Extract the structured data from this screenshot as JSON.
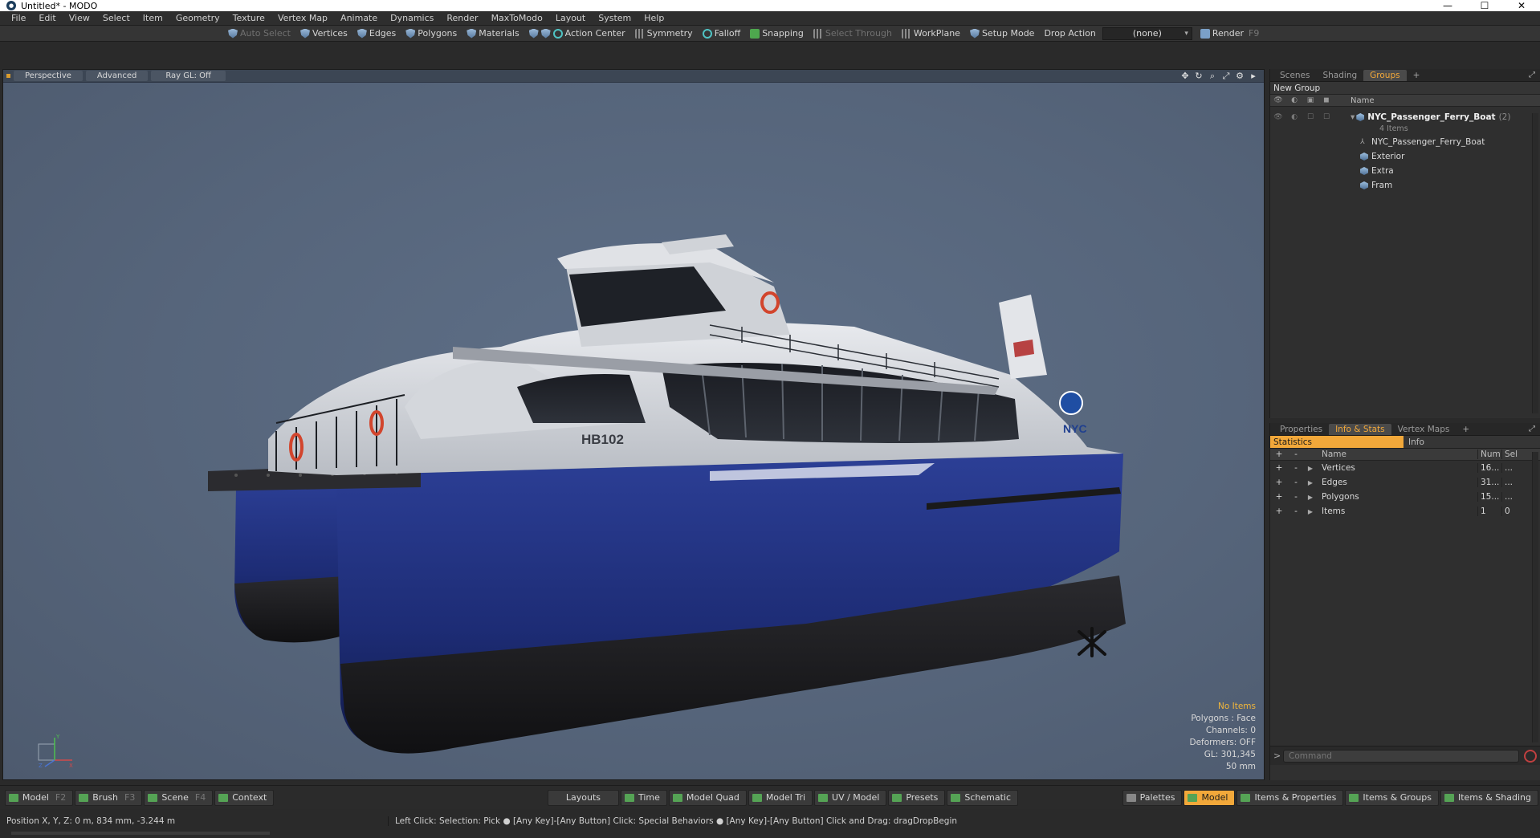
{
  "window": {
    "title": "Untitled* - MODO",
    "minimize": "—",
    "maximize": "☐",
    "close": "✕"
  },
  "menu": [
    "File",
    "Edit",
    "View",
    "Select",
    "Item",
    "Geometry",
    "Texture",
    "Vertex Map",
    "Animate",
    "Dynamics",
    "Render",
    "MaxToModo",
    "Layout",
    "System",
    "Help"
  ],
  "toolbar": {
    "auto_select": "Auto Select",
    "vertices": "Vertices",
    "edges": "Edges",
    "polygons": "Polygons",
    "materials": "Materials",
    "action_center": "Action Center",
    "symmetry": "Symmetry",
    "falloff": "Falloff",
    "snapping": "Snapping",
    "select_through": "Select Through",
    "workplane": "WorkPlane",
    "setup_mode": "Setup Mode",
    "drop_action": "Drop Action",
    "drop_value": "(none)",
    "render": "Render",
    "render_key": "F9"
  },
  "viewport": {
    "tabs": [
      "Perspective",
      "Advanced",
      "Ray GL: Off"
    ],
    "hull_label": "HB102",
    "logo_text": "NYC",
    "stats": {
      "no_items": "No Items",
      "polygons": "Polygons : Face",
      "channels": "Channels: 0",
      "deformers": "Deformers: OFF",
      "gl": "GL: 301,345",
      "lens": "50 mm"
    },
    "axis": {
      "x": "X",
      "y": "Y",
      "z": "Z"
    }
  },
  "colors": {
    "accent": "#f2a83a",
    "hull_blue": "#1e2f7a",
    "viewport_bg": "#56657b"
  },
  "scene_panel": {
    "tabs": [
      "Scenes",
      "Shading",
      "Groups"
    ],
    "active_tab": "Groups",
    "plus": "+",
    "new_group": "New Group",
    "column_name": "Name",
    "group": {
      "name": "NYC_Passenger_Ferry_Boat",
      "count": "(2)",
      "items_text": "4 Items"
    },
    "children": [
      "NYC_Passenger_Ferry_Boat",
      "Exterior",
      "Extra",
      "Fram"
    ]
  },
  "info_panel": {
    "tabs": [
      "Properties",
      "Info & Stats",
      "Vertex Maps"
    ],
    "active_tab": "Info & Stats",
    "plus": "+",
    "sub_tabs": [
      "Statistics",
      "Info"
    ],
    "columns": {
      "name": "Name",
      "num": "Num",
      "sel": "Sel"
    },
    "rows": [
      {
        "name": "Vertices",
        "num": "16...",
        "sel": "..."
      },
      {
        "name": "Edges",
        "num": "31...",
        "sel": "..."
      },
      {
        "name": "Polygons",
        "num": "15...",
        "sel": "..."
      },
      {
        "name": "Items",
        "num": "1",
        "sel": "0"
      }
    ],
    "command_placeholder": "Command"
  },
  "bottom_left": [
    {
      "label": "Model",
      "key": "F2"
    },
    {
      "label": "Brush",
      "key": "F3"
    },
    {
      "label": "Scene",
      "key": "F4"
    },
    {
      "label": "Context",
      "key": ""
    }
  ],
  "bottom_center": [
    "Layouts",
    "Time",
    "Model Quad",
    "Model Tri",
    "UV / Model",
    "Presets",
    "Schematic"
  ],
  "bottom_right": [
    "Palettes",
    "Model",
    "Items & Properties",
    "Items & Groups",
    "Items & Shading"
  ],
  "status": {
    "position": "Position X, Y, Z:  0 m, 834 mm, -3.244 m",
    "hint": "Left Click: Selection: Pick ● [Any Key]-[Any Button] Click: Special Behaviors ● [Any Key]-[Any Button] Click and Drag: dragDropBegin"
  }
}
